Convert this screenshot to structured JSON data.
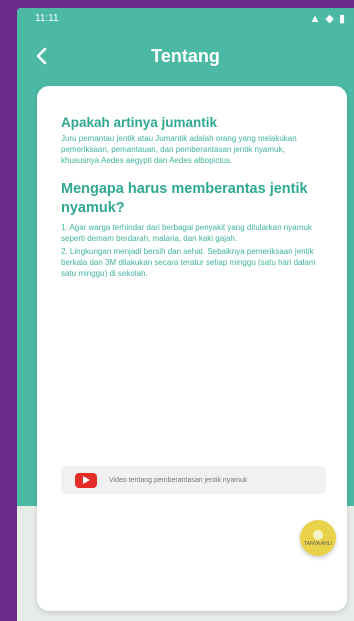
{
  "status_bar": {
    "time": "11:11",
    "icons": "▲ ◆ ▮"
  },
  "header": {
    "title": "Tentang",
    "back_icon": "chevron-left-icon"
  },
  "content": {
    "section1": {
      "title": "Apakah artinya jumantik",
      "body": "Juru pemantau jentik atau Jumantik adalah orang yang melakukan pemeriksaan, pemantauan, dan pemberantasan jentik nyamuk, khususnya Aedes aegypti dan Aedes albopictus."
    },
    "section2": {
      "title": "Mengapa harus memberantas jentik nyamuk?",
      "body1": "1. Agar warga terhindar dari berbagai penyakit yang ditularkan nyamuk seperti demam berdarah, malaria, dan kaki gajah.",
      "body2": "2. Lingkungan menjadi bersih dan sehat. Sebaiknya pemeriksaan jentik berkala dan 3M dilakukan secara teratur setiap minggu (satu hari dalam satu minggu) di sekolah."
    },
    "video_link": {
      "label": "Video tentang pemberantasan jentik nyamuk",
      "icon": "youtube-icon"
    }
  },
  "fab": {
    "label": "TANYA AHLI",
    "icon": "info-icon"
  },
  "colors": {
    "accent": "#4cb9a5",
    "text": "#2fa892",
    "background": "#6a2c8a",
    "fab": "#e9d14a"
  }
}
